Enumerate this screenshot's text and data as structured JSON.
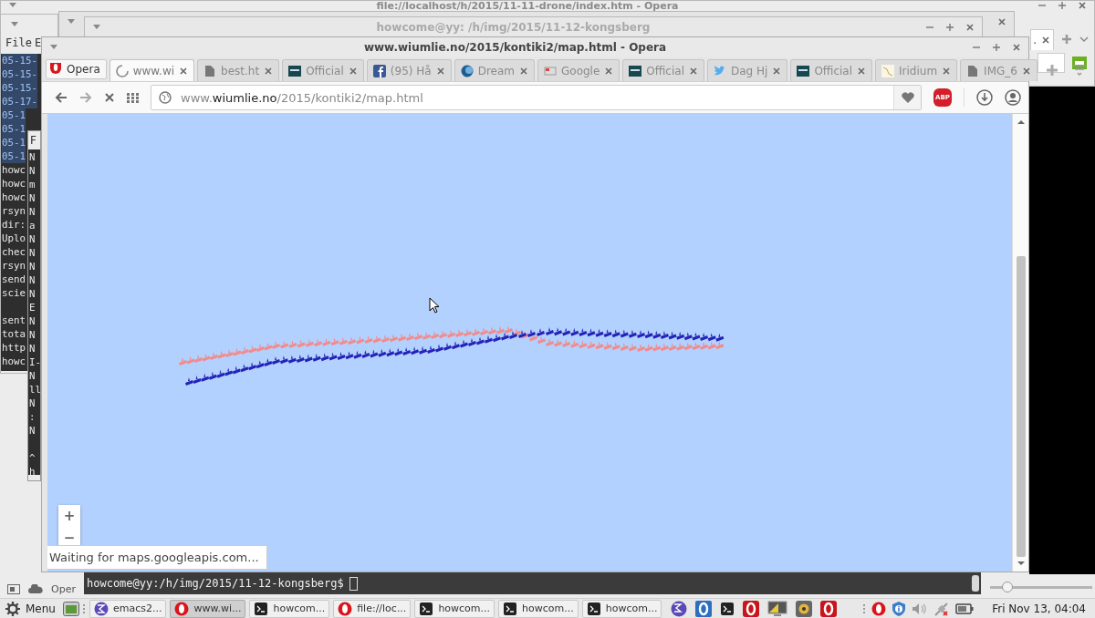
{
  "back_browser": {
    "title": "file://localhost/h/2015/11-11-drone/index.htm - Opera",
    "partial_tab": "."
  },
  "terminal_window": {
    "title": "howcome@yy: /h/img/2015/11-12-kongsberg"
  },
  "terminal_left": {
    "menu": [
      "File",
      "E"
    ],
    "blocks": [
      [
        {
          "text": "05-15-",
          "selected": true
        },
        {
          "text": "05-15-",
          "selected": true
        },
        {
          "text": "05-15-",
          "selected": true
        },
        {
          "text": "05-17-",
          "selected": true
        },
        {
          "text": "05-1",
          "selected": true
        },
        {
          "text": "05-1",
          "selected": true
        },
        {
          "text": "05-1",
          "selected": true
        },
        {
          "text": "05-1",
          "selected": true
        },
        {
          "text": "howc",
          "selected": false
        },
        {
          "text": "howc",
          "selected": false
        },
        {
          "text": "howc",
          "selected": false
        },
        {
          "text": "rsyn",
          "selected": false
        },
        {
          "text": "dir:",
          "selected": false
        },
        {
          "text": "Uplo",
          "selected": false
        },
        {
          "text": "chec",
          "selected": false
        },
        {
          "text": "rsyn",
          "selected": false
        },
        {
          "text": "send",
          "selected": false
        },
        {
          "text": "scie",
          "selected": false
        }
      ],
      [
        {
          "text": "sent",
          "selected": false
        },
        {
          "text": "tota",
          "selected": false
        },
        {
          "text": "http",
          "selected": false
        },
        {
          "text": "howc",
          "selected": false
        }
      ]
    ]
  },
  "terminal_mid": {
    "menu": "F",
    "blocks": [
      [
        "N",
        "N",
        "m",
        "N",
        "N",
        "a",
        "N",
        "N",
        "N",
        "N",
        "N",
        "E",
        "N",
        "N",
        "N",
        "I-",
        "N",
        "ll",
        "N",
        ":",
        "N"
      ],
      [
        "^",
        "h"
      ]
    ]
  },
  "browser": {
    "title": "www.wiumlie.no/2015/kontiki2/map.html - Opera",
    "opera_button": "Opera",
    "tabs": [
      {
        "label": "www.wi",
        "kind": "loading",
        "selected": true
      },
      {
        "label": "best.ht",
        "kind": "page",
        "selected": false
      },
      {
        "label": "Official",
        "kind": "kontiki",
        "selected": false
      },
      {
        "label": "(95) Hå",
        "kind": "facebook",
        "selected": false
      },
      {
        "label": "Dream",
        "kind": "circle",
        "selected": false
      },
      {
        "label": "Google",
        "kind": "google",
        "selected": false
      },
      {
        "label": "Official",
        "kind": "kontiki",
        "selected": false
      },
      {
        "label": "Dag Hj",
        "kind": "twitter",
        "selected": false
      },
      {
        "label": "Official",
        "kind": "kontiki",
        "selected": false
      },
      {
        "label": "Iridium",
        "kind": "iridium",
        "selected": false
      },
      {
        "label": "IMG_6",
        "kind": "page",
        "selected": false
      }
    ],
    "address": "www.**wiumlie.no**/2015/kontiki2/map.html",
    "adblock": "ABP",
    "map_zoom": [
      "+",
      "−"
    ],
    "status": "Waiting for maps.googleapis.com..."
  },
  "bottom_terminal": {
    "prompt": "howcome@yy:/h/img/2015/11-12-kongsberg$"
  },
  "panel": {
    "label": "Oper",
    "slider": {
      "level": 0.17
    }
  },
  "taskbar": {
    "menu": "Menu",
    "tasks": [
      {
        "label": "emacs2...",
        "kind": "emacs",
        "selected": false
      },
      {
        "label": "www.wi...",
        "kind": "opera",
        "selected": true
      },
      {
        "label": "howcom...",
        "kind": "terminal",
        "selected": false
      },
      {
        "label": "file://loc...",
        "kind": "opera",
        "selected": false
      },
      {
        "label": "howcom...",
        "kind": "terminal",
        "selected": false
      },
      {
        "label": "howcom...",
        "kind": "terminal",
        "selected": false
      },
      {
        "label": "howcom...",
        "kind": "terminal",
        "selected": false
      }
    ],
    "clock": "Fri Nov 13, 04:04"
  }
}
